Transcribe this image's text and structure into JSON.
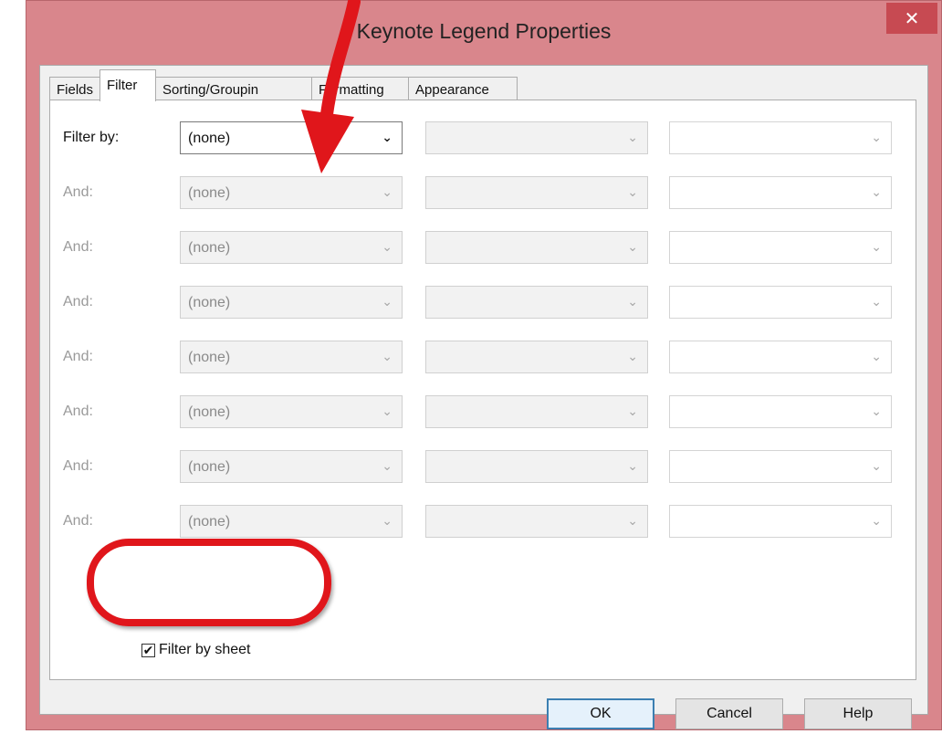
{
  "window": {
    "title": "Keynote Legend Properties",
    "close_label": "✕"
  },
  "tabs": [
    {
      "label": "Fields",
      "active": false
    },
    {
      "label": "Filter",
      "active": true
    },
    {
      "label": "Sorting/Groupin",
      "active": false
    },
    {
      "label": "Formatting",
      "active": false
    },
    {
      "label": "Appearance",
      "active": false
    }
  ],
  "filter_rows": [
    {
      "label": "Filter by:",
      "field": "(none)",
      "enabled": true
    },
    {
      "label": "And:",
      "field": "(none)",
      "enabled": false
    },
    {
      "label": "And:",
      "field": "(none)",
      "enabled": false
    },
    {
      "label": "And:",
      "field": "(none)",
      "enabled": false
    },
    {
      "label": "And:",
      "field": "(none)",
      "enabled": false
    },
    {
      "label": "And:",
      "field": "(none)",
      "enabled": false
    },
    {
      "label": "And:",
      "field": "(none)",
      "enabled": false
    },
    {
      "label": "And:",
      "field": "(none)",
      "enabled": false
    }
  ],
  "filter_by_sheet": {
    "label": "Filter by sheet",
    "checked": true
  },
  "buttons": {
    "ok": "OK",
    "cancel": "Cancel",
    "help": "Help"
  },
  "colors": {
    "titlebar": "#d9868c",
    "close": "#c74a52",
    "annotation": "#e0161b"
  }
}
